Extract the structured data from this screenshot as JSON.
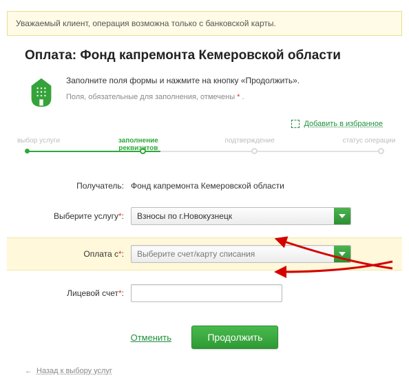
{
  "alert": {
    "text": "Уважаемый клиент, операция возможна только с банковской карты."
  },
  "title": "Оплата: Фонд капремонта Кемеровской области",
  "intro": {
    "line1": "Заполните поля формы и нажмите на кнопку «Продолжить».",
    "line2_prefix": "Поля, обязательные для заполнения, отмечены ",
    "required_mark": "*",
    "line2_suffix": " ."
  },
  "fav_link": "Добавить в избранное",
  "steps": {
    "s1": "выбор услуги",
    "s2": "заполнение реквизитов",
    "s3": "подтверждение",
    "s4": "статус операции"
  },
  "form": {
    "recipient_label": "Получатель:",
    "recipient_value": "Фонд капремонта Кемеровской области",
    "service_label": "Выберите услугу",
    "service_value": "Взносы по г.Новокузнецк",
    "pay_from_label": "Оплата с",
    "pay_from_placeholder": "Выберите счет/карту списания",
    "account_label": "Лицевой счет",
    "account_value": "",
    "star": "*",
    "colon": ":"
  },
  "actions": {
    "cancel": "Отменить",
    "continue": "Продолжить"
  },
  "back_link": "Назад к выбору услуг"
}
